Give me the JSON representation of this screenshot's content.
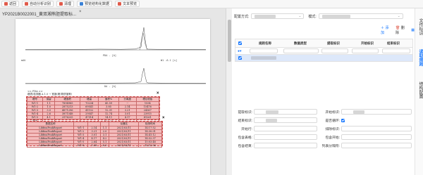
{
  "toolbar": {
    "buttons": [
      {
        "label": "返回",
        "color": "#e05b4b"
      },
      {
        "label": "自动分析识别",
        "color": "#e05b4b"
      },
      {
        "label": "清理",
        "color": "#e05b4b"
      },
      {
        "label": "预览结构化数据",
        "color": "#3b82d6"
      },
      {
        "label": "文本预览",
        "color": "#e05b4b"
      }
    ]
  },
  "document": {
    "file_name": "YP2021B0022001_黄双湘熊胆提取标...",
    "close": "×",
    "chart1_label": "PDA - [A]",
    "chart2_label": "DA - [A]",
    "chart_axis": "mAU",
    "chart2_right": "W1 -6.1 [s]",
    "table1_caption": "<< PDA >>",
    "table1_title": "峰表(检测器 A 1.0 → 宽度(峰)物质值等)",
    "table1_rows": [
      [
        "峰号",
        "保留",
        "峰面积",
        "峰高",
        "面积%",
        "分离度",
        "理论塔板"
      ],
      [
        "W1-1",
        "1.1",
        "7894985",
        "70234",
        "45.59",
        "--",
        "1534"
      ],
      [
        "W1-2",
        "1.0",
        "2875213",
        "69541",
        "3.85",
        "2.14",
        "15476"
      ],
      [
        "W1-3",
        "3.0",
        "4871296",
        "41152",
        "12.31",
        "3.21",
        "24367"
      ],
      [
        "W1-4",
        "2.6",
        "3871548",
        "29547",
        "12.74",
        "3.01",
        "23915"
      ],
      [
        "W1-5",
        "4.1",
        "2976235",
        "47514",
        "14.11",
        "4.17",
        "41261"
      ],
      [
        "总计",
        "",
        "",
        "",
        "100.00",
        "",
        ""
      ]
    ],
    "table2_rows": [
      [
        "数据名称",
        "",
        "",
        "",
        "仪器名",
        "检测时间"
      ],
      [
        "LibfmsPeakReport",
        "W1-1",
        "2.14",
        "1.1",
        "2021/03/11",
        "14:17:52"
      ],
      [
        "LibfmsPeakReport",
        "W1-2",
        "3.21",
        "2.0",
        "2021/03/11",
        "14:30:01"
      ],
      [
        "LibfmsPeakReport",
        "W1-3",
        "3.01",
        "3.1",
        "2021/03/11",
        "14:41:12"
      ],
      [
        "LibfmsPeakReport",
        "W1-4",
        "4.17",
        "4.2",
        "2021/03/11",
        "14:52:37"
      ],
      [
        "LibfmsPeakReport",
        "W1-5",
        "2.64",
        "5.1",
        "2021/03/11",
        "15:03:48"
      ],
      [
        "LibfmsPeakReport",
        "W1-6",
        "1.98",
        "6.0",
        "2021/03/11",
        "15:15:06"
      ]
    ],
    "xmark": "×"
  },
  "config": {
    "mode_label": "配置方式:",
    "template_label": "模式:",
    "add_label": "添加",
    "delete_label": "删除",
    "columns": [
      "规则名称",
      "数据类型",
      "提取标识",
      "开始标识",
      "结束标识"
    ],
    "select_placeholder": "请选择"
  },
  "form": {
    "extract_id": "提取标识:",
    "start_id": "开始标识:",
    "end_id": "结束标识:",
    "loop": "是否循环:",
    "start_row": "开始行:",
    "exclude_row": "排除标识:",
    "check_table": "包含表格:",
    "check_start": "包含开始:",
    "check_end": "包含结束:",
    "col_split": "列表分隔符:"
  },
  "side_tabs": [
    "文件标识",
    "读取规则",
    "结构配置"
  ]
}
